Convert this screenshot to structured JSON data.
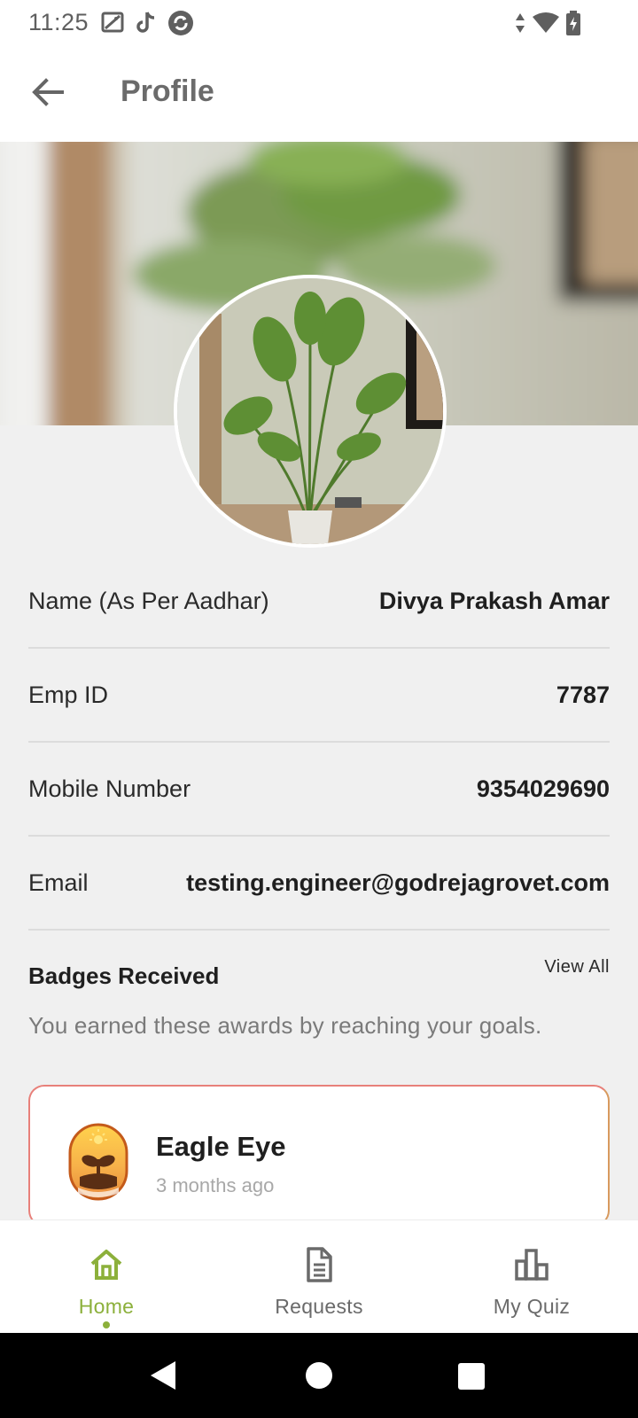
{
  "status_bar": {
    "time": "11:25",
    "left_icons": [
      "image-off-icon",
      "tiktok-icon",
      "refresh-icon"
    ],
    "right_icons": [
      "data-arrows-icon",
      "wifi-icon",
      "battery-charging-icon"
    ]
  },
  "app_bar": {
    "back_icon": "arrow-left-icon",
    "title": "Profile"
  },
  "profile": {
    "cover_image": "blurred-plant-photo",
    "avatar_image": "palm-plant-photo",
    "fields": [
      {
        "label": "Name (As Per Aadhar)",
        "value": "Divya Prakash Amar"
      },
      {
        "label": "Emp ID",
        "value": "7787"
      },
      {
        "label": "Mobile Number",
        "value": "9354029690"
      },
      {
        "label": "Email",
        "value": "testing.engineer@godrejagrovet.com"
      }
    ]
  },
  "badges": {
    "title": "Badges Received",
    "view_all": "View All",
    "subtitle": "You earned these awards by reaching your goals.",
    "items": [
      {
        "name": "Eagle Eye",
        "time": "3 months ago",
        "icon": "sprout-badge-icon"
      }
    ]
  },
  "bottom_nav": {
    "items": [
      {
        "label": "Home",
        "icon": "home-icon",
        "active": true
      },
      {
        "label": "Requests",
        "icon": "document-icon",
        "active": false
      },
      {
        "label": "My Quiz",
        "icon": "bar-chart-icon",
        "active": false
      }
    ],
    "accent": "#8cb03b"
  },
  "system_nav": {
    "buttons": [
      "back-triangle-icon",
      "home-circle-icon",
      "recents-square-icon"
    ]
  }
}
